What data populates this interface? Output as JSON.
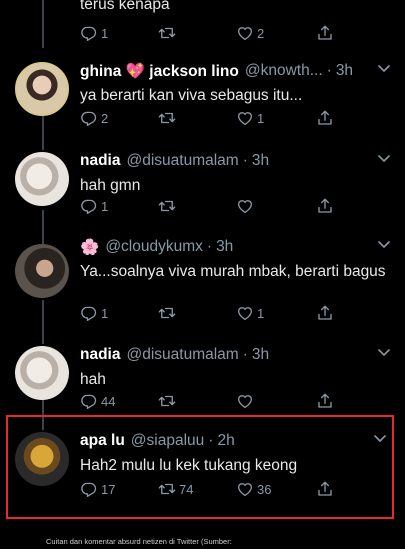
{
  "top_tweet": {
    "text": "terus kenapa",
    "replies": "1",
    "retweets": "",
    "likes": "2"
  },
  "tweets": [
    {
      "name": "ghina",
      "emoji": "💖",
      "name2": "jackson lino",
      "handle": "@knowth...",
      "time": "3h",
      "text": "ya berarti kan viva sebagus itu...",
      "replies": "2",
      "retweets": "",
      "likes": "1"
    },
    {
      "name": "nadia",
      "handle": "@disuatumalam",
      "time": "3h",
      "text": "hah gmn",
      "replies": "1",
      "retweets": "",
      "likes": ""
    },
    {
      "emoji": "🌸",
      "handle": "@cloudykumx",
      "time": "3h",
      "text": "Ya...soalnya viva murah mbak, berarti bagus",
      "replies": "1",
      "retweets": "",
      "likes": "1"
    },
    {
      "name": "nadia",
      "handle": "@disuatumalam",
      "time": "3h",
      "text": "hah",
      "replies": "44",
      "retweets": "",
      "likes": ""
    },
    {
      "name": "apa lu",
      "handle": "@siapaluu",
      "time": "2h",
      "text": "Hah2 mulu lu kek tukang keong",
      "replies": "17",
      "retweets": "74",
      "likes": "36"
    }
  ],
  "header_separator": "·",
  "caption": "Cuitan dan komentar absurd netizen di Twitter (Sumber:",
  "colors": {
    "background": "#000000",
    "secondary_text": "#8899a6",
    "highlight_border": "#e32b2b",
    "thread_line": "#38444d"
  },
  "icons": [
    "reply-icon",
    "retweet-icon",
    "like-icon",
    "share-icon",
    "chevron-down-icon"
  ]
}
